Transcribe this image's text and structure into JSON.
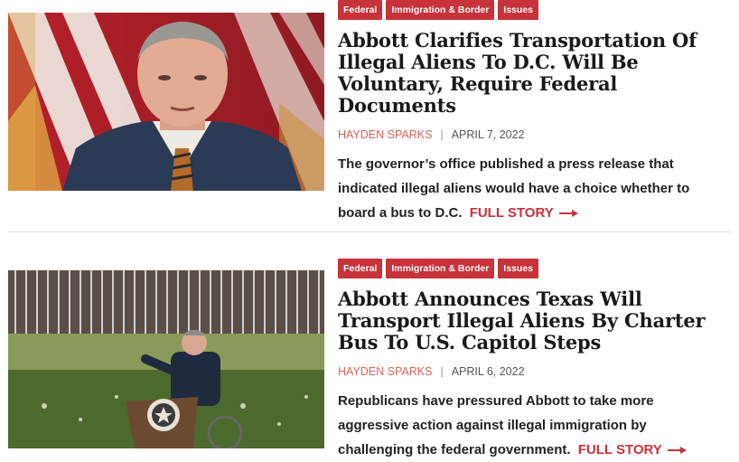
{
  "articles": [
    {
      "tags": [
        "Federal",
        "Immigration & Border",
        "Issues"
      ],
      "title": "Abbott Clarifies Transportation Of Illegal Aliens To D.C. Will Be Voluntary, Require Federal Documents",
      "author": "HAYDEN SPARKS",
      "separator": "|",
      "date": "APRIL 7, 2022",
      "excerpt": "The governor’s office published a press release that indicated illegal aliens would have a choice whether to board a bus to D.C.",
      "more_label": "FULL STORY"
    },
    {
      "tags": [
        "Federal",
        "Immigration & Border",
        "Issues"
      ],
      "title": "Abbott Announces Texas Will Transport Illegal Aliens By Charter Bus To U.S. Capitol Steps",
      "author": "HAYDEN SPARKS",
      "separator": "|",
      "date": "APRIL 6, 2022",
      "excerpt": "Republicans have pressured Abbott to take more aggressive action against illegal immigration by challenging the federal government.",
      "more_label": "FULL STORY"
    }
  ],
  "colors": {
    "accent": "#c8323a",
    "author": "#d8645c",
    "title": "#1a1a1a",
    "divider": "#e2e2e2"
  },
  "icons": {
    "more_arrow": "arrow-right-icon"
  }
}
